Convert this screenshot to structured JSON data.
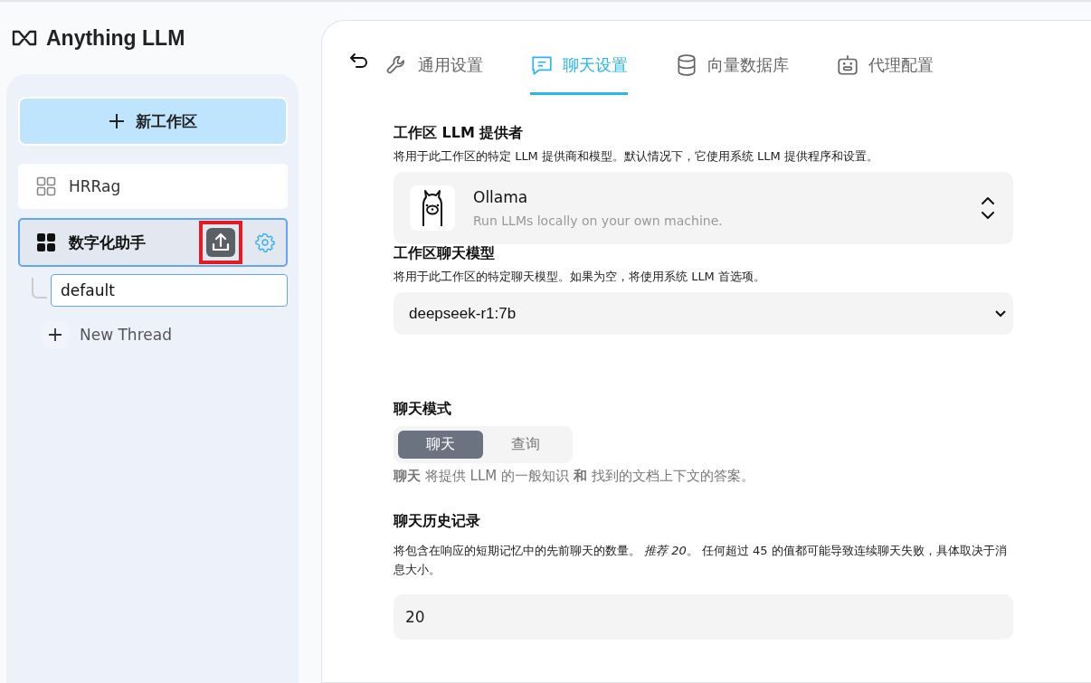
{
  "brand": {
    "name": "Anything LLM"
  },
  "sidebar": {
    "new_workspace_button": "新工作区",
    "workspaces": [
      {
        "name": "HRRag",
        "selected": false
      },
      {
        "name": "数字化助手",
        "selected": true,
        "upload_highlighted": true,
        "threads": [
          {
            "name": "default",
            "selected": true
          }
        ]
      }
    ],
    "new_thread": "New Thread"
  },
  "tabs": [
    {
      "label": "通用设置",
      "kind": "general",
      "selected": false
    },
    {
      "label": "聊天设置",
      "kind": "chat",
      "selected": true
    },
    {
      "label": "向量数据库",
      "kind": "vector",
      "selected": false
    },
    {
      "label": "代理配置",
      "kind": "agent",
      "selected": false
    }
  ],
  "provider": {
    "title": "工作区 LLM 提供者",
    "description": "将用于此工作区的特定 LLM 提供商和模型。默认情况下，它使用系统 LLM 提供程序和设置。",
    "name": "Ollama",
    "tagline": "Run LLMs locally on your own machine."
  },
  "model": {
    "title": "工作区聊天模型",
    "description": "将用于此工作区的特定聊天模型。如果为空，将使用系统 LLM 首选项。",
    "value": "deepseek-r1:7b"
  },
  "chat_mode": {
    "title": "聊天模式",
    "options": [
      {
        "label": "聊天",
        "selected": true
      },
      {
        "label": "查询",
        "selected": false
      }
    ],
    "description": "**聊天** 将提供 LLM 的一般知识 **和** 找到的文档上下文的答案。"
  },
  "history": {
    "title": "聊天历史记录",
    "description": "将包含在响应的短期记忆中的先前聊天的数量。 *推荐 20*。 任何超过 45 的值都可能导致连续聊天失败，具体取决于消息大小。",
    "value": "20"
  }
}
